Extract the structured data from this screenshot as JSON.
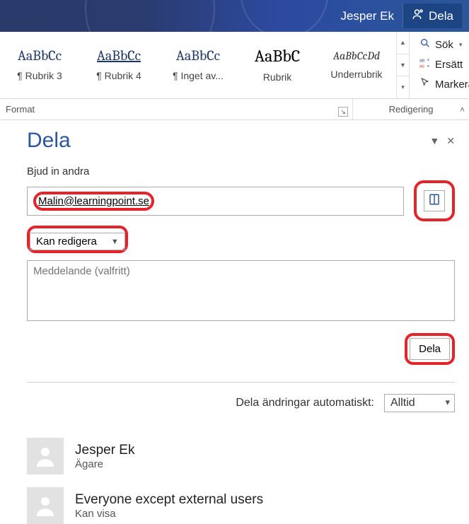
{
  "titlebar": {
    "user": "Jesper Ek",
    "share_label": "Dela"
  },
  "ribbon": {
    "styles": [
      {
        "preview": "AaBbCc",
        "preview_class": "",
        "label": "¶ Rubrik 3"
      },
      {
        "preview": "AaBbCc",
        "preview_class": "underline",
        "label": "¶ Rubrik 4"
      },
      {
        "preview": "AaBbCc",
        "preview_class": "",
        "label": "¶ Inget av..."
      },
      {
        "preview": "AaBbC",
        "preview_class": "black",
        "label": "Rubrik"
      },
      {
        "preview": "AaBbCcDd",
        "preview_class": "italic",
        "label": "Underrubrik"
      }
    ],
    "editing": {
      "search": "Sök",
      "replace": "Ersätt",
      "select": "Markera"
    }
  },
  "group_labels": {
    "format": "Format",
    "editing": "Redigering"
  },
  "share_pane": {
    "title": "Dela",
    "invite_label": "Bjud in andra",
    "email_value": "Malin@learningpoint.se",
    "permission_value": "Kan redigera",
    "message_placeholder": "Meddelande (valfritt)",
    "share_button": "Dela",
    "auto_label": "Dela ändringar automatiskt:",
    "auto_value": "Alltid",
    "people": [
      {
        "name": "Jesper Ek",
        "role": "Ägare"
      },
      {
        "name": "Everyone except external users",
        "role": "Kan visa"
      }
    ]
  }
}
